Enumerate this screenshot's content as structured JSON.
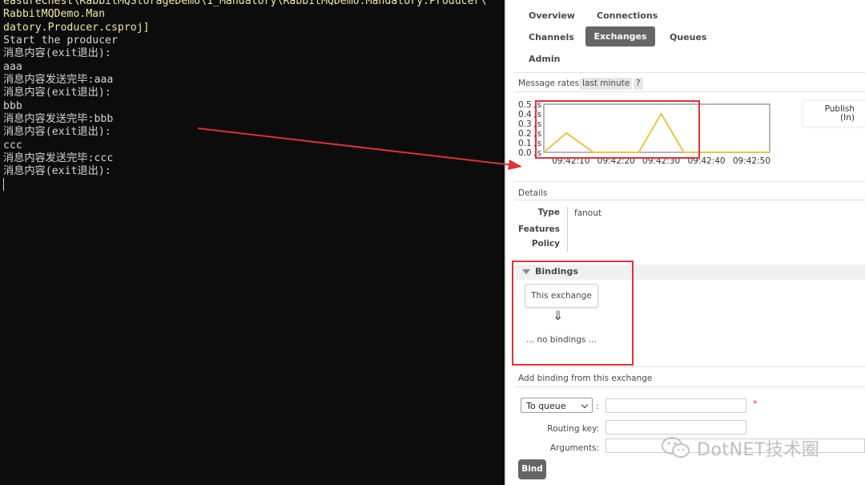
{
  "console": {
    "path_line1": "easureChest\\RabbitMQStorageDemo\\1_Mandatory\\RabbitMQDemo.Mandatory.Producer\\",
    "path_line2": "RabbitMQDemo.Man",
    "path_line3": "datory.Producer.csproj]",
    "lines": [
      "Start the producer",
      "消息内容(exit退出):",
      "aaa",
      "消息内容发送完毕:aaa",
      "消息内容(exit退出):",
      "bbb",
      "消息内容发送完毕:bbb",
      "消息内容(exit退出):",
      "ccc",
      "消息内容发送完毕:ccc",
      "消息内容(exit退出):"
    ]
  },
  "nav": {
    "overview": "Overview",
    "connections": "Connections",
    "channels": "Channels",
    "exchanges": "Exchanges",
    "queues": "Queues",
    "admin": "Admin"
  },
  "message_rates": {
    "label": "Message rates",
    "period": "last minute",
    "help": "?"
  },
  "publish": {
    "line1": "Publish",
    "line2": "(In)"
  },
  "chart_data": {
    "type": "line",
    "title": "",
    "xlabel": "",
    "ylabel": "",
    "x_ticks": [
      "09:42:10",
      "09:42:20",
      "09:42:30",
      "09:42:40",
      "09:42:50"
    ],
    "y_ticks": [
      "0.5 /s",
      "0.4 /s",
      "0.3 /s",
      "0.2 /s",
      "0.1 /s",
      "0.0 /s"
    ],
    "ylim": [
      0,
      0.5
    ],
    "grid": false,
    "legend": "none",
    "series": [
      {
        "color": "#e8c54a",
        "x": [
          "09:42:04",
          "09:42:09",
          "09:42:15",
          "09:42:25",
          "09:42:30",
          "09:42:35",
          "09:42:54"
        ],
        "values": [
          0.0,
          0.2,
          0.0,
          0.0,
          0.4,
          0.0,
          0.0
        ]
      }
    ]
  },
  "details": {
    "label": "Details",
    "type_key": "Type",
    "type_value": "fanout",
    "features_key": "Features",
    "policy_key": "Policy"
  },
  "bindings": {
    "title": "Bindings",
    "this_exchange": "This exchange",
    "arrow": "⇓",
    "none": "... no bindings ..."
  },
  "add_binding": {
    "label": "Add binding from this exchange",
    "destination_type": "To queue",
    "colon": ":",
    "required_mark": "*",
    "routing_key_label": "Routing key:",
    "arguments_label": "Arguments:",
    "bind_button": "Bind"
  },
  "watermark": {
    "text": "DotNET技术圈",
    "icon": "wechat-icon"
  },
  "colors": {
    "highlight_red": "#e0313b",
    "chart_line": "#e8c54a",
    "active_tab": "#666666"
  }
}
